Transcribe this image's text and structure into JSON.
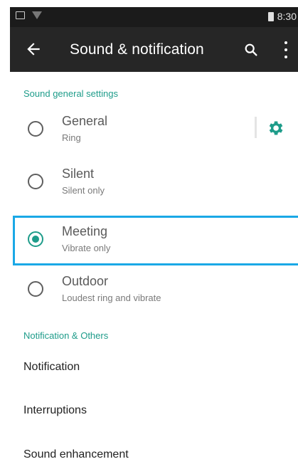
{
  "status_bar": {
    "time": "8:30"
  },
  "toolbar": {
    "title": "Sound & notification"
  },
  "sections": {
    "sound_header": "Sound general settings",
    "notification_header": "Notification & Others"
  },
  "profiles": [
    {
      "title": "General",
      "subtitle": "Ring",
      "selected": false
    },
    {
      "title": "Silent",
      "subtitle": "Silent only",
      "selected": false
    },
    {
      "title": "Meeting",
      "subtitle": "Vibrate only",
      "selected": true
    },
    {
      "title": "Outdoor",
      "subtitle": "Loudest ring and vibrate",
      "selected": false
    }
  ],
  "others": [
    {
      "label": "Notification"
    },
    {
      "label": "Interruptions"
    },
    {
      "label": "Sound enhancement"
    }
  ],
  "colors": {
    "accent": "#1e9c8a",
    "highlight": "#1aa8e6",
    "toolbar": "#262626"
  }
}
